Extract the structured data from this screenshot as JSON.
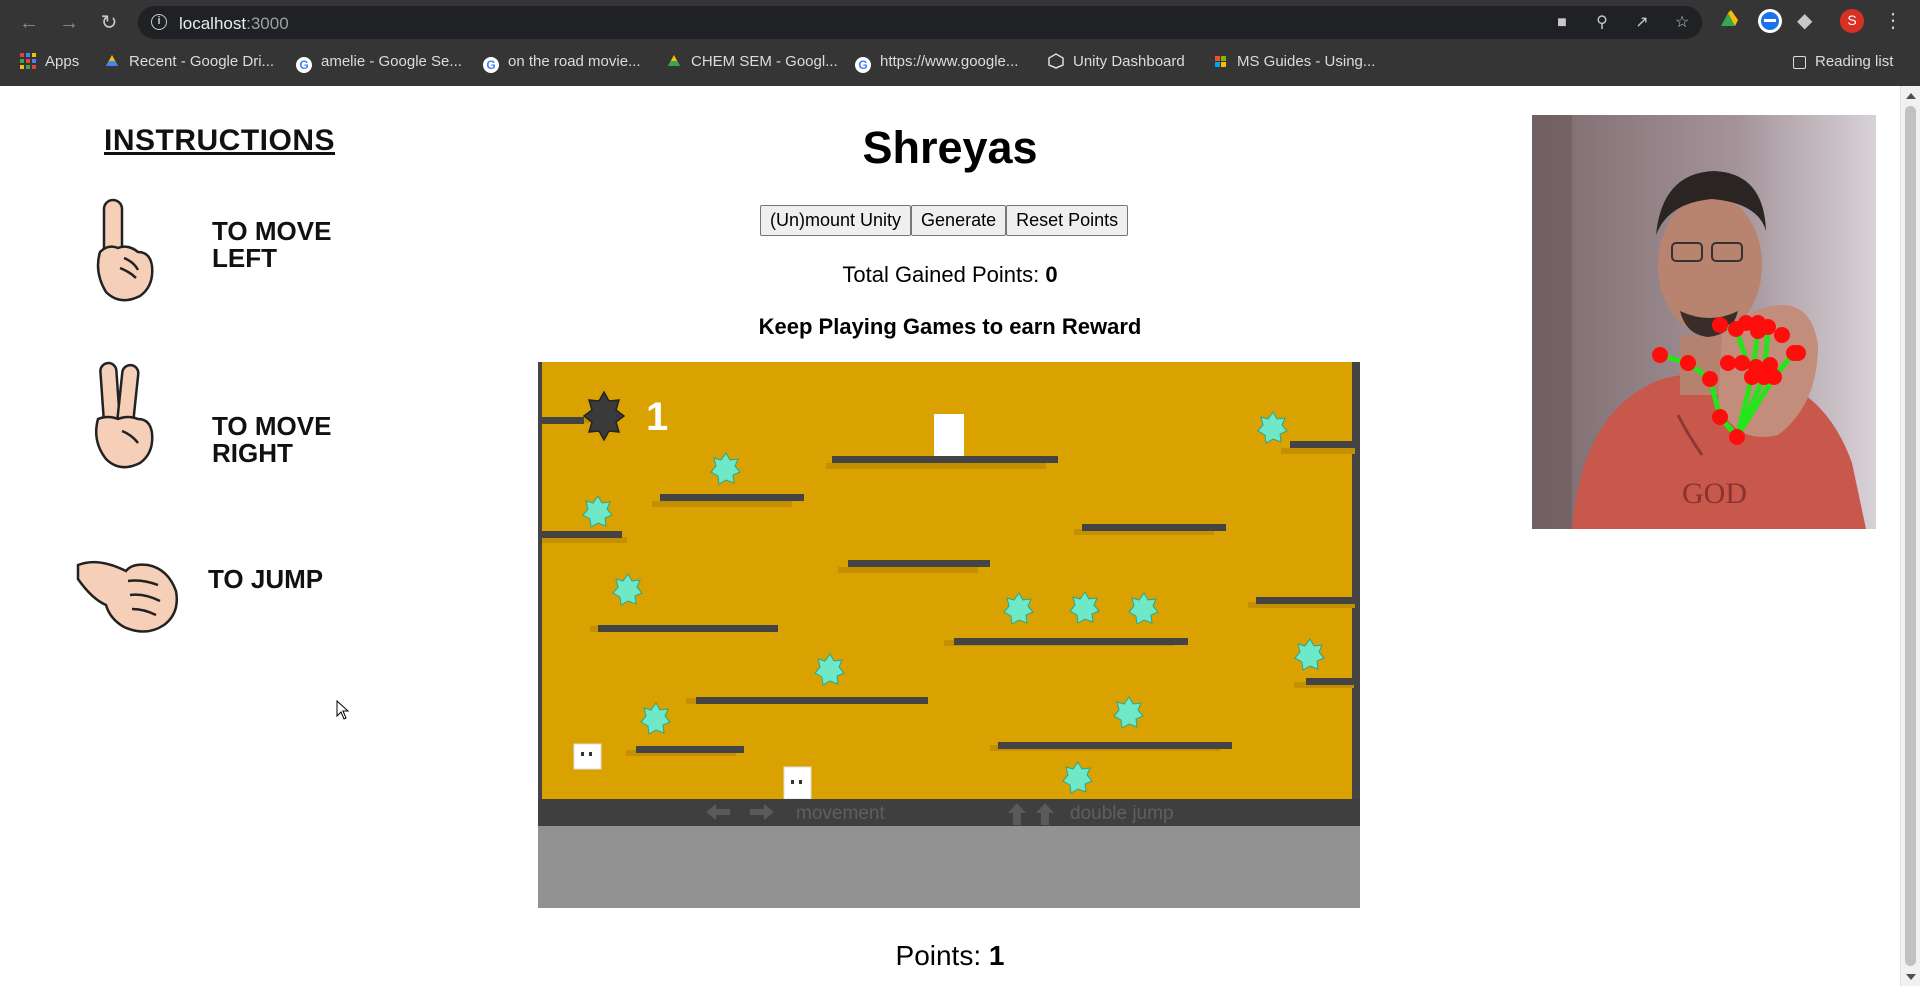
{
  "browser": {
    "url_host": "localhost",
    "url_port": ":3000",
    "bookmarks": [
      {
        "label": "Apps",
        "icon": "apps-grid-icon"
      },
      {
        "label": "Recent - Google Dri...",
        "icon": "google-drive-icon"
      },
      {
        "label": "amelie - Google Se...",
        "icon": "google-icon"
      },
      {
        "label": "on the road movie...",
        "icon": "google-icon"
      },
      {
        "label": "CHEM SEM - Googl...",
        "icon": "google-drive-icon"
      },
      {
        "label": "https://www.google...",
        "icon": "google-icon"
      },
      {
        "label": "Unity Dashboard",
        "icon": "unity-icon"
      },
      {
        "label": "MS Guides - Using...",
        "icon": "ms-guides-icon"
      }
    ],
    "reading_list": "Reading list",
    "profile_initial": "S"
  },
  "instructions": {
    "title": "INSTRUCTIONS",
    "items": [
      {
        "line1": "TO MOVE",
        "line2": "LEFT",
        "gesture": "index-finger-up"
      },
      {
        "line1": "TO MOVE",
        "line2": "RIGHT",
        "gesture": "peace-sign"
      },
      {
        "line1": "TO JUMP",
        "line2": "",
        "gesture": "thumb-sideways"
      }
    ]
  },
  "main": {
    "title": "Shreyas",
    "buttons": {
      "unmount": "(Un)mount Unity",
      "generate": "Generate",
      "reset": "Reset Points"
    },
    "total_label": "Total Gained Points: ",
    "total_value": "0",
    "keep_playing": "Keep Playing Games to earn Reward",
    "points_label": "Points: ",
    "points_value": "1"
  },
  "game": {
    "score": "1",
    "hint_movement": "movement",
    "hint_double_jump": "double jump",
    "colors": {
      "background": "#d9a200",
      "platform": "#444444",
      "gem": "#6fe8c8",
      "hud": "#3f3f3f",
      "footer": "#929292"
    }
  }
}
